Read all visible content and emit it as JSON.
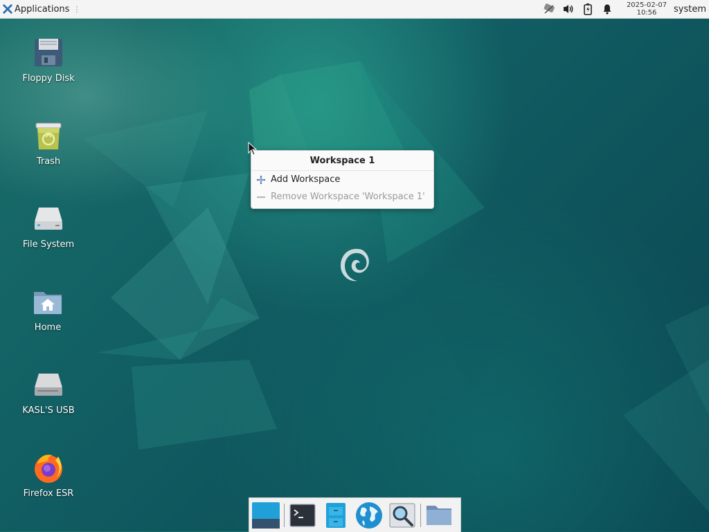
{
  "top_panel": {
    "applications_label": "Applications",
    "clock_date": "2025-02-07",
    "clock_time": "10:56",
    "user": "system",
    "tray_icons": [
      "network-icon",
      "volume-icon",
      "battery-icon",
      "notification-bell-icon"
    ]
  },
  "desktop": {
    "icons": [
      {
        "label": "Floppy Disk",
        "icon": "floppy-disk-icon"
      },
      {
        "label": "Trash",
        "icon": "trash-icon"
      },
      {
        "label": "File System",
        "icon": "file-system-icon"
      },
      {
        "label": "Home",
        "icon": "home-folder-icon"
      },
      {
        "label": "KASL'S USB",
        "icon": "usb-drive-icon"
      },
      {
        "label": "Firefox ESR",
        "icon": "firefox-icon"
      }
    ]
  },
  "context_menu": {
    "title": "Workspace 1",
    "items": [
      {
        "label": "Add Workspace",
        "icon": "plus-icon",
        "enabled": true
      },
      {
        "label": "Remove Workspace 'Workspace 1'",
        "icon": "minus-icon",
        "enabled": false
      }
    ]
  },
  "dock": {
    "launchers": [
      "show-desktop-icon",
      "terminal-icon",
      "file-manager-icon",
      "web-browser-icon",
      "app-finder-icon",
      "folder-icon"
    ]
  },
  "colors": {
    "accent": "#1fa0d8",
    "panel_bg": "#f4f4f4",
    "desktop_bg": "#115e63"
  }
}
